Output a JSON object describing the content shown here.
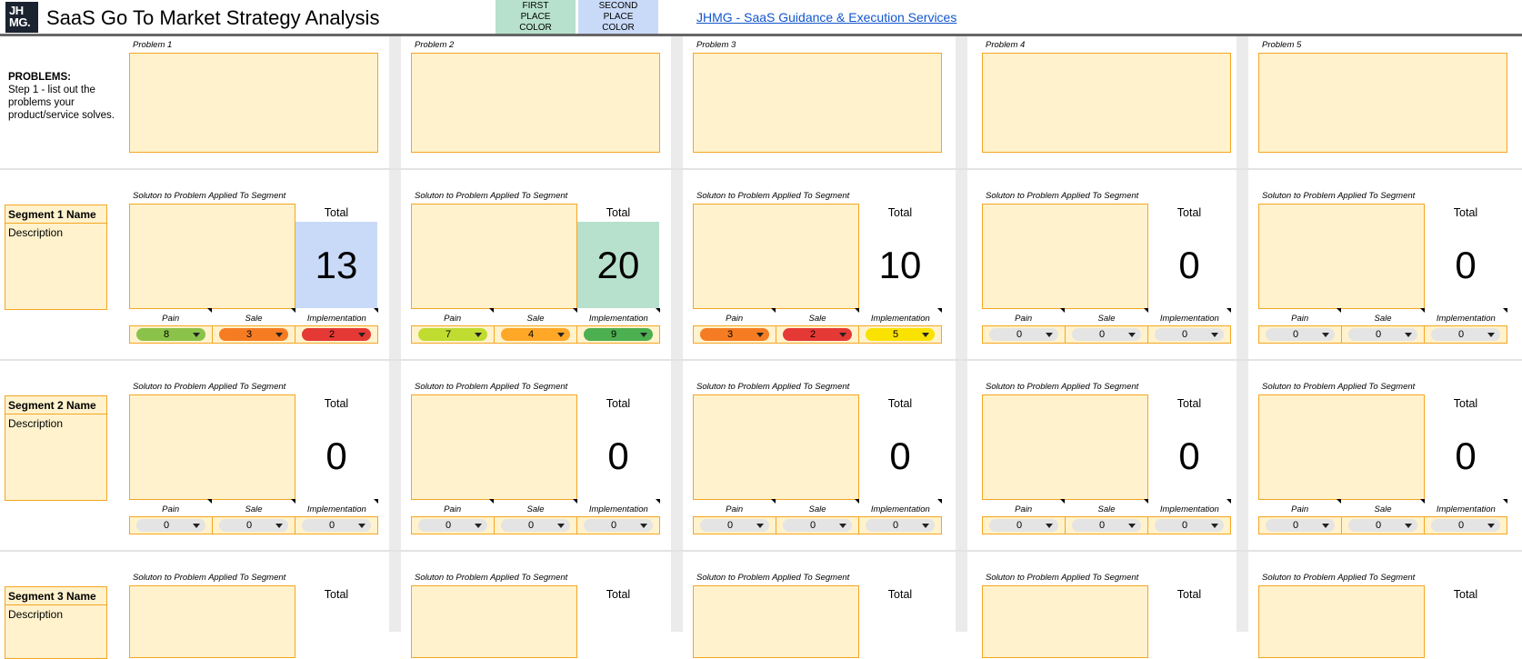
{
  "header": {
    "logo_text": "JH\nMG.",
    "title": "SaaS Go To Market Strategy Analysis",
    "first_place": {
      "label": "FIRST PLACE COLOR",
      "color": "#b7e1cd"
    },
    "second_place": {
      "label": "SECOND PLACE COLOR",
      "color": "#c9daf8"
    },
    "link": "JHMG - SaaS Guidance & Execution Services"
  },
  "problems_section": {
    "heading": "PROBLEMS:",
    "instructions": "Step 1 - list out the problems your product/service solves.",
    "problems": [
      "Problem 1",
      "Problem 2",
      "Problem 3",
      "Problem 4",
      "Problem 5"
    ]
  },
  "labels": {
    "solution": "Soluton to Problem Applied To Segment",
    "total": "Total",
    "pain": "Pain",
    "sale": "Sale",
    "implementation": "Implementation"
  },
  "segments": [
    {
      "name": "Segment 1 Name",
      "description": "Description",
      "cells": [
        {
          "total": "13",
          "total_bg": "#c9daf8",
          "pain": "8",
          "sale": "3",
          "impl": "2",
          "pain_color": "#8bc34a",
          "sale_color": "#f57c22",
          "impl_color": "#e53935"
        },
        {
          "total": "20",
          "total_bg": "#b7e1cd",
          "pain": "7",
          "sale": "4",
          "impl": "9",
          "pain_color": "#c0dc30",
          "sale_color": "#ffa726",
          "impl_color": "#4caf50"
        },
        {
          "total": "10",
          "total_bg": "",
          "pain": "3",
          "sale": "2",
          "impl": "5",
          "pain_color": "#f57c22",
          "sale_color": "#e53935",
          "impl_color": "#f9e100"
        },
        {
          "total": "0",
          "total_bg": "",
          "pain": "0",
          "sale": "0",
          "impl": "0",
          "pain_color": "#e4e4e4",
          "sale_color": "#e4e4e4",
          "impl_color": "#e4e4e4"
        },
        {
          "total": "0",
          "total_bg": "",
          "pain": "0",
          "sale": "0",
          "impl": "0",
          "pain_color": "#e4e4e4",
          "sale_color": "#e4e4e4",
          "impl_color": "#e4e4e4"
        }
      ]
    },
    {
      "name": "Segment 2 Name",
      "description": "Description",
      "cells": [
        {
          "total": "0",
          "total_bg": "",
          "pain": "0",
          "sale": "0",
          "impl": "0",
          "pain_color": "#e4e4e4",
          "sale_color": "#e4e4e4",
          "impl_color": "#e4e4e4"
        },
        {
          "total": "0",
          "total_bg": "",
          "pain": "0",
          "sale": "0",
          "impl": "0",
          "pain_color": "#e4e4e4",
          "sale_color": "#e4e4e4",
          "impl_color": "#e4e4e4"
        },
        {
          "total": "0",
          "total_bg": "",
          "pain": "0",
          "sale": "0",
          "impl": "0",
          "pain_color": "#e4e4e4",
          "sale_color": "#e4e4e4",
          "impl_color": "#e4e4e4"
        },
        {
          "total": "0",
          "total_bg": "",
          "pain": "0",
          "sale": "0",
          "impl": "0",
          "pain_color": "#e4e4e4",
          "sale_color": "#e4e4e4",
          "impl_color": "#e4e4e4"
        },
        {
          "total": "0",
          "total_bg": "",
          "pain": "0",
          "sale": "0",
          "impl": "0",
          "pain_color": "#e4e4e4",
          "sale_color": "#e4e4e4",
          "impl_color": "#e4e4e4"
        }
      ]
    },
    {
      "name": "Segment 3 Name",
      "description": "Description",
      "cells": [
        {},
        {},
        {},
        {},
        {}
      ]
    }
  ]
}
